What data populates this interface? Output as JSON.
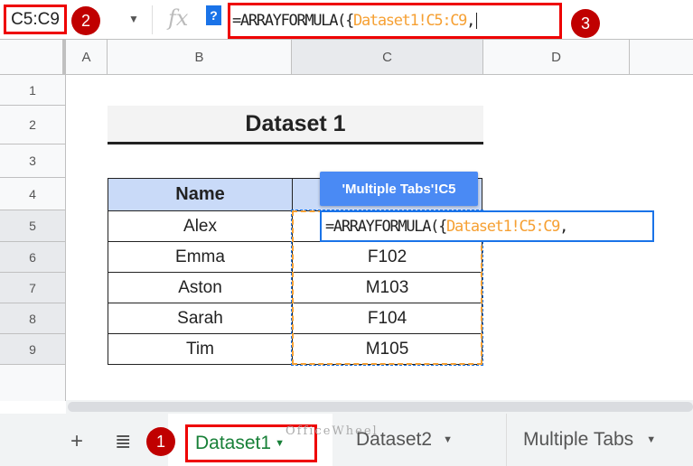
{
  "name_box": "C5:C9",
  "formula_bar": {
    "fx": "fx",
    "help": "?",
    "prefix": "=ARRAYFORMULA({",
    "ref": "Dataset1!C5:C9",
    "suffix": ","
  },
  "badges": [
    "1",
    "2",
    "3"
  ],
  "columns": [
    "A",
    "B",
    "C",
    "D"
  ],
  "rows": [
    "1",
    "2",
    "3",
    "4",
    "5",
    "6",
    "7",
    "8",
    "9"
  ],
  "title": "Dataset 1",
  "table": {
    "headers": [
      "Name",
      ""
    ],
    "rows": [
      [
        "Alex",
        ""
      ],
      [
        "Emma",
        "F102"
      ],
      [
        "Aston",
        "M103"
      ],
      [
        "Sarah",
        "F104"
      ],
      [
        "Tim",
        "M105"
      ]
    ]
  },
  "tooltip": "'Multiple Tabs'!C5",
  "cell_editor": {
    "prefix": "=ARRAYFORMULA({",
    "ref": "Dataset1!C5:C9",
    "suffix": ","
  },
  "tabs": {
    "add": "+",
    "list": "≣",
    "items": [
      "Dataset1",
      "Dataset2",
      "Multiple Tabs"
    ]
  },
  "watermark": "OfficeWheel"
}
